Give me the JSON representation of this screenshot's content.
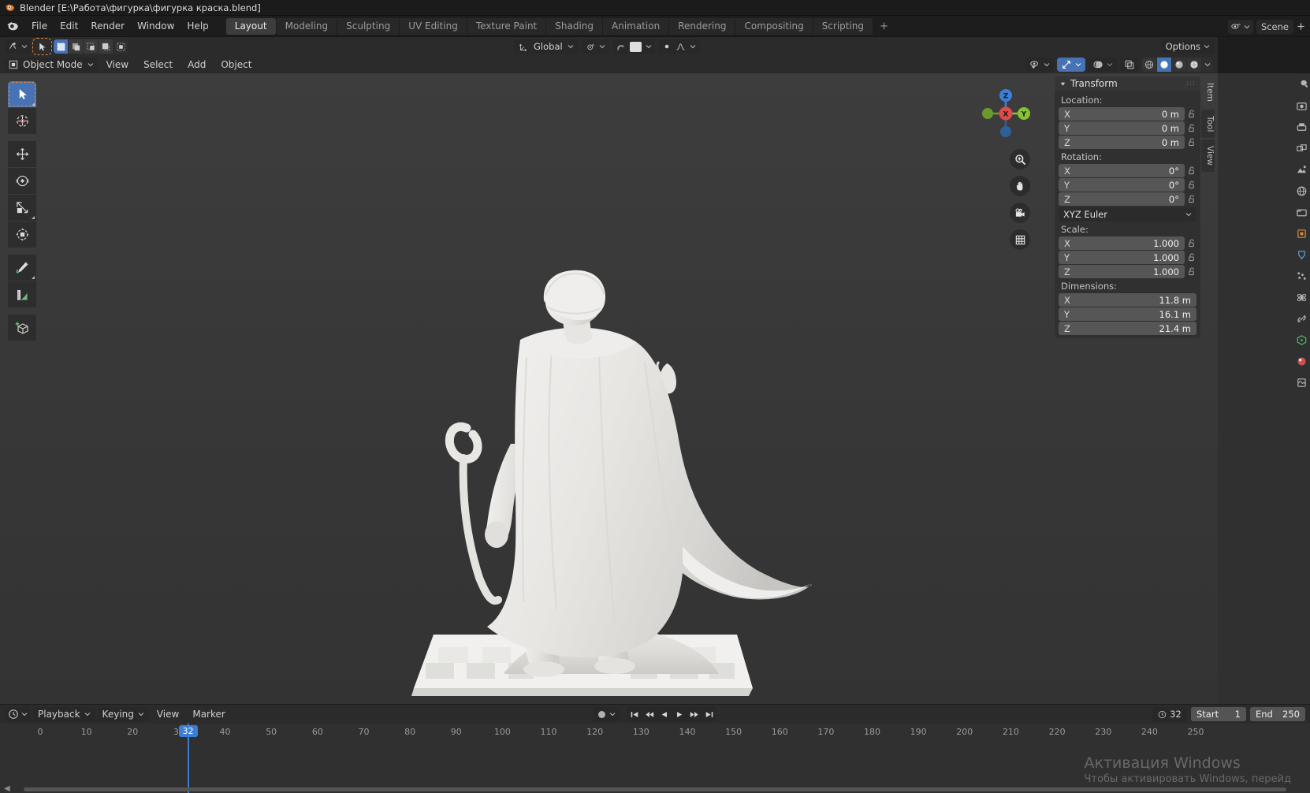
{
  "window": {
    "title": "Blender [E:\\Работа\\фигурка\\фигурка краска.blend]",
    "logo_icon": "blender-logo-icon"
  },
  "topbar": {
    "menus": [
      {
        "label": "File",
        "name": "menu-file"
      },
      {
        "label": "Edit",
        "name": "menu-edit"
      },
      {
        "label": "Render",
        "name": "menu-render"
      },
      {
        "label": "Window",
        "name": "menu-window"
      },
      {
        "label": "Help",
        "name": "menu-help"
      }
    ],
    "tabs": [
      {
        "label": "Layout",
        "active": true
      },
      {
        "label": "Modeling",
        "active": false
      },
      {
        "label": "Sculpting",
        "active": false
      },
      {
        "label": "UV Editing",
        "active": false
      },
      {
        "label": "Texture Paint",
        "active": false
      },
      {
        "label": "Shading",
        "active": false
      },
      {
        "label": "Animation",
        "active": false
      },
      {
        "label": "Rendering",
        "active": false
      },
      {
        "label": "Compositing",
        "active": false
      },
      {
        "label": "Scripting",
        "active": false
      }
    ],
    "add_tab_label": "+",
    "scene_name": "Scene",
    "scene_icon": "scene-icon",
    "browse_scene_icon": "browse-scene-icon"
  },
  "viewport_header": {
    "editor_type_icon": "editor-type-icon",
    "select_mode_icon": "select-tool-icon",
    "snap_toggles": [
      "vertex",
      "edge",
      "face",
      "volume",
      "center"
    ],
    "orientation_label": "Global",
    "orientation_icon": "transform-orientation-icon",
    "pivot_icon": "pivot-point-icon",
    "snap_icon": "snap-magnet-icon",
    "proportional_icon": "proportional-edit-icon",
    "options_label": "Options",
    "visibility_icon": "visibility-icon",
    "gizmo_icon": "gizmo-icon",
    "overlays_icon": "overlays-icon",
    "xray_icon": "xray-icon",
    "shading_modes": [
      "wireframe",
      "solid",
      "material",
      "rendered"
    ],
    "active_shading": "solid"
  },
  "viewport_subheader": {
    "mode_label": "Object Mode",
    "mode_icon": "object-mode-icon",
    "menus": [
      {
        "label": "View",
        "name": "viewport-menu-view"
      },
      {
        "label": "Select",
        "name": "viewport-menu-select"
      },
      {
        "label": "Add",
        "name": "viewport-menu-add"
      },
      {
        "label": "Object",
        "name": "viewport-menu-object"
      }
    ]
  },
  "toolbar": {
    "tools": [
      {
        "name": "tweak-select-box-tool",
        "icon": "cursor-arrow-icon",
        "active": true,
        "corner": true
      },
      {
        "name": "cursor-tool",
        "icon": "3d-cursor-icon",
        "active": false,
        "corner": false
      },
      {
        "name": "move-tool",
        "icon": "move-arrows-icon",
        "active": false,
        "corner": false
      },
      {
        "name": "rotate-tool",
        "icon": "rotate-icon",
        "active": false,
        "corner": false
      },
      {
        "name": "scale-tool",
        "icon": "scale-icon",
        "active": false,
        "corner": true
      },
      {
        "name": "transform-tool",
        "icon": "transform-icon",
        "active": false,
        "corner": false
      },
      {
        "name": "annotate-tool",
        "icon": "pencil-annotate-icon",
        "active": false,
        "corner": true
      },
      {
        "name": "measure-tool",
        "icon": "ruler-measure-icon",
        "active": false,
        "corner": false
      },
      {
        "name": "add-cube-tool",
        "icon": "add-cube-icon",
        "active": false,
        "corner": false
      }
    ]
  },
  "nav_gizmo": {
    "axes": [
      {
        "label": "Z",
        "color": "#3e7fd6"
      },
      {
        "label": "X",
        "color": "#e04a4a"
      },
      {
        "label": "Y",
        "color": "#86c232"
      }
    ],
    "buttons": [
      {
        "name": "zoom-view-button",
        "icon": "magnifier-plus-icon"
      },
      {
        "name": "pan-view-button",
        "icon": "hand-icon"
      },
      {
        "name": "camera-view-button",
        "icon": "camera-icon"
      },
      {
        "name": "toggle-ortho-button",
        "icon": "grid-icon"
      }
    ]
  },
  "n_panel": {
    "title": "Transform",
    "collapse_icon": "triangle-down-icon",
    "sections": [
      {
        "label": "Location:",
        "name": "location-section",
        "rows": [
          {
            "key": "X",
            "value": "0 m"
          },
          {
            "key": "Y",
            "value": "0 m"
          },
          {
            "key": "Z",
            "value": "0 m"
          }
        ]
      },
      {
        "label": "Rotation:",
        "name": "rotation-section",
        "rows": [
          {
            "key": "X",
            "value": "0°"
          },
          {
            "key": "Y",
            "value": "0°"
          },
          {
            "key": "Z",
            "value": "0°"
          }
        ]
      }
    ],
    "rotation_mode": "XYZ Euler",
    "scale": {
      "label": "Scale:",
      "rows": [
        {
          "key": "X",
          "value": "1.000"
        },
        {
          "key": "Y",
          "value": "1.000"
        },
        {
          "key": "Z",
          "value": "1.000"
        }
      ]
    },
    "dimensions": {
      "label": "Dimensions:",
      "rows": [
        {
          "key": "X",
          "value": "11.8 m"
        },
        {
          "key": "Y",
          "value": "16.1 m"
        },
        {
          "key": "Z",
          "value": "21.4 m"
        }
      ]
    },
    "lock_icon": "lock-open-icon",
    "tabs": [
      {
        "label": "Item",
        "active": true
      },
      {
        "label": "Tool",
        "active": false
      },
      {
        "label": "View",
        "active": false
      }
    ]
  },
  "properties_rail": {
    "icons": [
      "tool-properties-icon",
      "render-properties-icon",
      "output-properties-icon",
      "view-layer-properties-icon",
      "scene-properties-icon",
      "world-properties-icon",
      "collection-properties-icon",
      "object-properties-icon",
      "modifier-properties-icon",
      "particle-properties-icon",
      "physics-properties-icon",
      "constraint-properties-icon",
      "data-properties-icon",
      "material-properties-icon",
      "texture-properties-icon"
    ]
  },
  "timeline": {
    "editor_icon": "timeline-editor-icon",
    "menus": [
      {
        "label": "Playback",
        "name": "timeline-menu-playback",
        "dropdown": true
      },
      {
        "label": "Keying",
        "name": "timeline-menu-keying",
        "dropdown": true
      },
      {
        "label": "View",
        "name": "timeline-menu-view",
        "dropdown": false
      },
      {
        "label": "Marker",
        "name": "timeline-menu-marker",
        "dropdown": false
      }
    ],
    "auto_key_icon": "record-dot-icon",
    "transport": [
      {
        "name": "jump-to-start-button",
        "icon": "jump-start-icon"
      },
      {
        "name": "prev-keyframe-button",
        "icon": "prev-keyframe-icon"
      },
      {
        "name": "play-reverse-button",
        "icon": "play-reverse-icon"
      },
      {
        "name": "play-button",
        "icon": "play-icon"
      },
      {
        "name": "next-keyframe-button",
        "icon": "next-keyframe-icon"
      },
      {
        "name": "jump-to-end-button",
        "icon": "jump-end-icon"
      }
    ],
    "current_frame": "32",
    "current_frame_icon": "clock-icon",
    "start_label": "Start",
    "start_value": "1",
    "end_label": "End",
    "end_value": "250",
    "ruler_ticks": [
      "0",
      "10",
      "20",
      "30",
      "40",
      "50",
      "60",
      "70",
      "80",
      "90",
      "100",
      "110",
      "120",
      "130",
      "140",
      "150",
      "160",
      "170",
      "180",
      "190",
      "200",
      "210",
      "220",
      "230",
      "240",
      "250"
    ],
    "playhead_frame": "32"
  },
  "watermark": {
    "line1": "Активация Windows",
    "line2": "Чтобы активировать Windows, перейд"
  },
  "colors": {
    "accent_blue": "#4772b3",
    "active_orange": "#e8873a",
    "axis_x": "#e04a4a",
    "axis_y": "#86c232",
    "axis_z": "#3e7fd6",
    "panel_bg": "#303030",
    "header_bg": "#2b2b2b",
    "viewport_bg": "#393939",
    "field_bg": "#565656"
  }
}
